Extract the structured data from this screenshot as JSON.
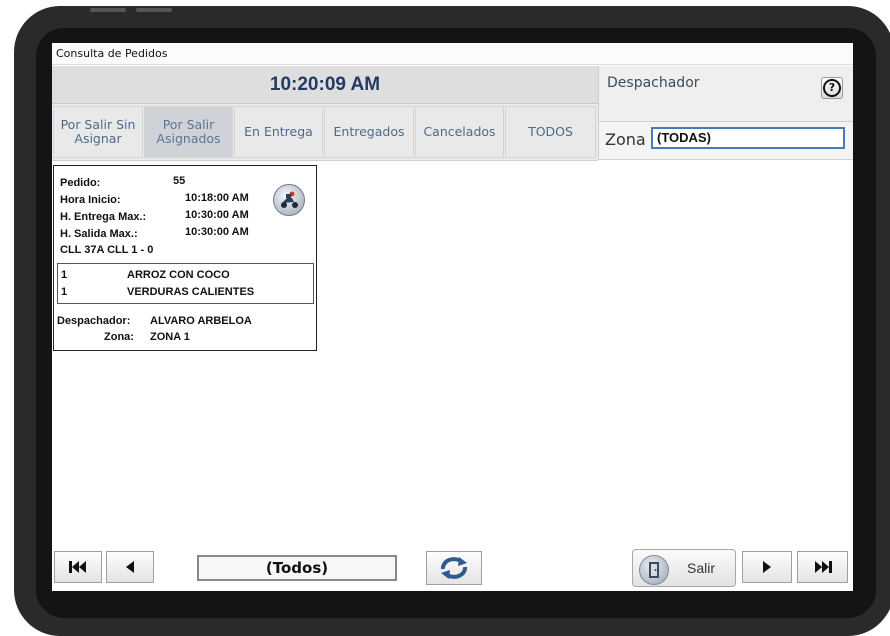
{
  "window": {
    "title": "Consulta de Pedidos"
  },
  "clock": "10:20:09 AM",
  "tabs": [
    {
      "label": "Por Salir Sin Asignar",
      "active": false
    },
    {
      "label": "Por Salir Asignados",
      "active": true
    },
    {
      "label": "En Entrega",
      "active": false
    },
    {
      "label": "Entregados",
      "active": false
    },
    {
      "label": "Cancelados",
      "active": false
    },
    {
      "label": "TODOS",
      "active": false
    }
  ],
  "side": {
    "despachador_label": "Despachador",
    "help_symbol": "?",
    "zona_label": "Zona",
    "zona_value": "(TODAS)"
  },
  "order": {
    "pedido_label": "Pedido:",
    "pedido": "55",
    "hora_inicio_label": "Hora Inicio:",
    "hora_inicio": "10:18:00 AM",
    "entrega_max_label": "H. Entrega Max.:",
    "entrega_max": "10:30:00 AM",
    "salida_max_label": "H. Salida Max.:",
    "salida_max": "10:30:00 AM",
    "address": "CLL 37A CLL 1 - 0",
    "items": [
      {
        "qty": "1",
        "name": "ARROZ CON COCO"
      },
      {
        "qty": "1",
        "name": "VERDURAS CALIENTES"
      }
    ],
    "despachador_label": "Despachador:",
    "despachador": "ALVARO ARBELOA",
    "zona_label": "Zona:",
    "zona": "ZONA 1"
  },
  "footer": {
    "filter_value": "(Todos)",
    "salir_label": "Salir"
  },
  "icons": {
    "first": "first-page-icon",
    "prev": "previous-icon",
    "refresh": "refresh-icon",
    "exit": "exit-door-icon",
    "next": "next-icon",
    "last": "last-page-icon",
    "delivery": "delivery-scooter-icon"
  },
  "colors": {
    "clock_text": "#243a64",
    "tab_text": "#4d6a8a",
    "zona_border": "#4a78b5",
    "active_tab": "#cfd3d8"
  }
}
